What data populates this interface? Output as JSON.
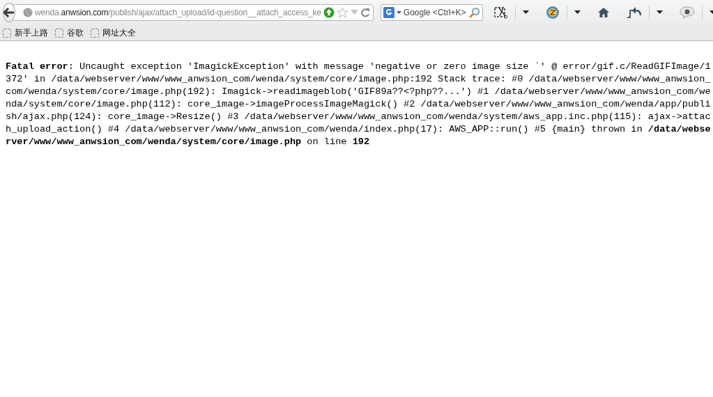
{
  "toolbar": {
    "address": {
      "host_prefix": "wenda.",
      "domain": "anwsion.com",
      "path": "/publish/ajax/attach_upload/id-question__attach_access_ke"
    },
    "search": {
      "placeholder": "Google <Ctrl+K>"
    }
  },
  "bookmarks": [
    {
      "label": "新手上路"
    },
    {
      "label": "谷歌"
    },
    {
      "label": "网址大全"
    }
  ],
  "error": {
    "text": "**Fatal error**: Uncaught exception 'ImagickException' with message 'negative or zero image size `' @ error/gif.c/ReadGIFImage/1372' in /data/webserver/www/www_anwsion_com/wenda/system/core/image.php:192 Stack trace: #0 /data/webserver/www/www_anwsion_com/wenda/system/core/image.php(192): Imagick->readimageblob('GIF89a??<?php??...') #1 /data/webserver/www/www_anwsion_com/wenda/system/core/image.php(112): core_image->imageProcessImageMagick() #2 /data/webserver/www/www_anwsion_com/wenda/app/publish/ajax.php(124): core_image->Resize() #3 /data/webserver/www/www_anwsion_com/wenda/system/aws_app.inc.php(115): ajax->attach_upload_action() #4 /data/webserver/www/www_anwsion_com/wenda/index.php(17): AWS_APP::run() #5 {main} thrown in **/data/webserver/www/www_anwsion_com/wenda/system/core/image.php** on line **192**"
  }
}
